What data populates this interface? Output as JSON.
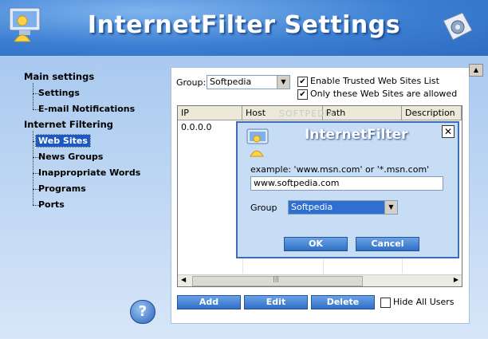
{
  "app": {
    "title": "InternetFilter Settings"
  },
  "sidebar": {
    "sections": [
      {
        "label": "Main settings",
        "items": [
          {
            "label": "Settings"
          },
          {
            "label": "E-mail Notifications"
          }
        ]
      },
      {
        "label": "Internet Filtering",
        "items": [
          {
            "label": "Web Sites",
            "selected": true
          },
          {
            "label": "News Groups"
          },
          {
            "label": "Inappropriate Words"
          },
          {
            "label": "Programs"
          },
          {
            "label": "Ports"
          }
        ]
      }
    ]
  },
  "main": {
    "group_label": "Group:",
    "group_value": "Softpedia",
    "enable_trusted_label": "Enable Trusted Web Sites List",
    "enable_trusted_checked": true,
    "only_these_label": "Only these Web Sites are allowed",
    "only_these_checked": true,
    "columns": [
      "IP",
      "Host",
      "Path",
      "Description"
    ],
    "rows": [
      {
        "ip": "0.0.0.0",
        "host": "",
        "path": "",
        "description": ""
      }
    ],
    "buttons": {
      "add": "Add",
      "edit": "Edit",
      "delete": "Delete"
    },
    "hide_all_users_label": "Hide All Users",
    "hide_all_users_checked": false
  },
  "dialog": {
    "title": "InternetFilter",
    "example_text": "example: 'www.msn.com' or '*.msn.com'",
    "host_value": "www.softpedia.com",
    "group_label": "Group",
    "group_value": "Softpedia",
    "ok_label": "OK",
    "cancel_label": "Cancel"
  },
  "watermark": "SOFTPEDIA",
  "icons": {
    "logo": "user-computer-icon",
    "settings": "settings-gear-icon",
    "help": "help-icon"
  },
  "colors": {
    "accent": "#2f6fc4",
    "selection": "#1c58c0",
    "dialog_bg": "#c7ddf6"
  }
}
